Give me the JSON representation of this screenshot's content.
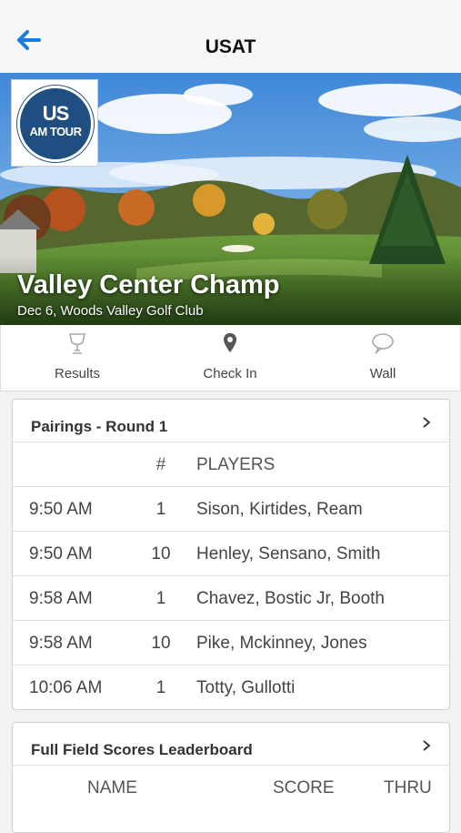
{
  "header": {
    "title": "USAT",
    "back_icon": "arrow-left-icon"
  },
  "hero": {
    "logo_line1": "US",
    "logo_line2": "AM TOUR",
    "event_name": "Valley Center Champ",
    "event_sub": "Dec 6, Woods Valley Golf Club"
  },
  "tabs": [
    {
      "label": "Results",
      "icon": "trophy-icon"
    },
    {
      "label": "Check In",
      "icon": "location-pin-icon"
    },
    {
      "label": "Wall",
      "icon": "speech-bubble-icon"
    }
  ],
  "pairings": {
    "title": "Pairings - Round 1",
    "col_num": "#",
    "col_players": "PLAYERS",
    "rows": [
      {
        "time": "9:50 AM",
        "num": "1",
        "players": "Sison, Kirtides, Ream"
      },
      {
        "time": "9:50 AM",
        "num": "10",
        "players": "Henley, Sensano, Smith"
      },
      {
        "time": "9:58 AM",
        "num": "1",
        "players": "Chavez, Bostic Jr, Booth"
      },
      {
        "time": "9:58 AM",
        "num": "10",
        "players": "Pike, Mckinney, Jones"
      },
      {
        "time": "10:06 AM",
        "num": "1",
        "players": "Totty, Gullotti"
      }
    ]
  },
  "leaderboard": {
    "title": "Full Field Scores Leaderboard",
    "col_name": "NAME",
    "col_score": "SCORE",
    "col_thru": "THRU"
  },
  "colors": {
    "accent": "#1a7be0",
    "logo_blue": "#1f4e80"
  }
}
